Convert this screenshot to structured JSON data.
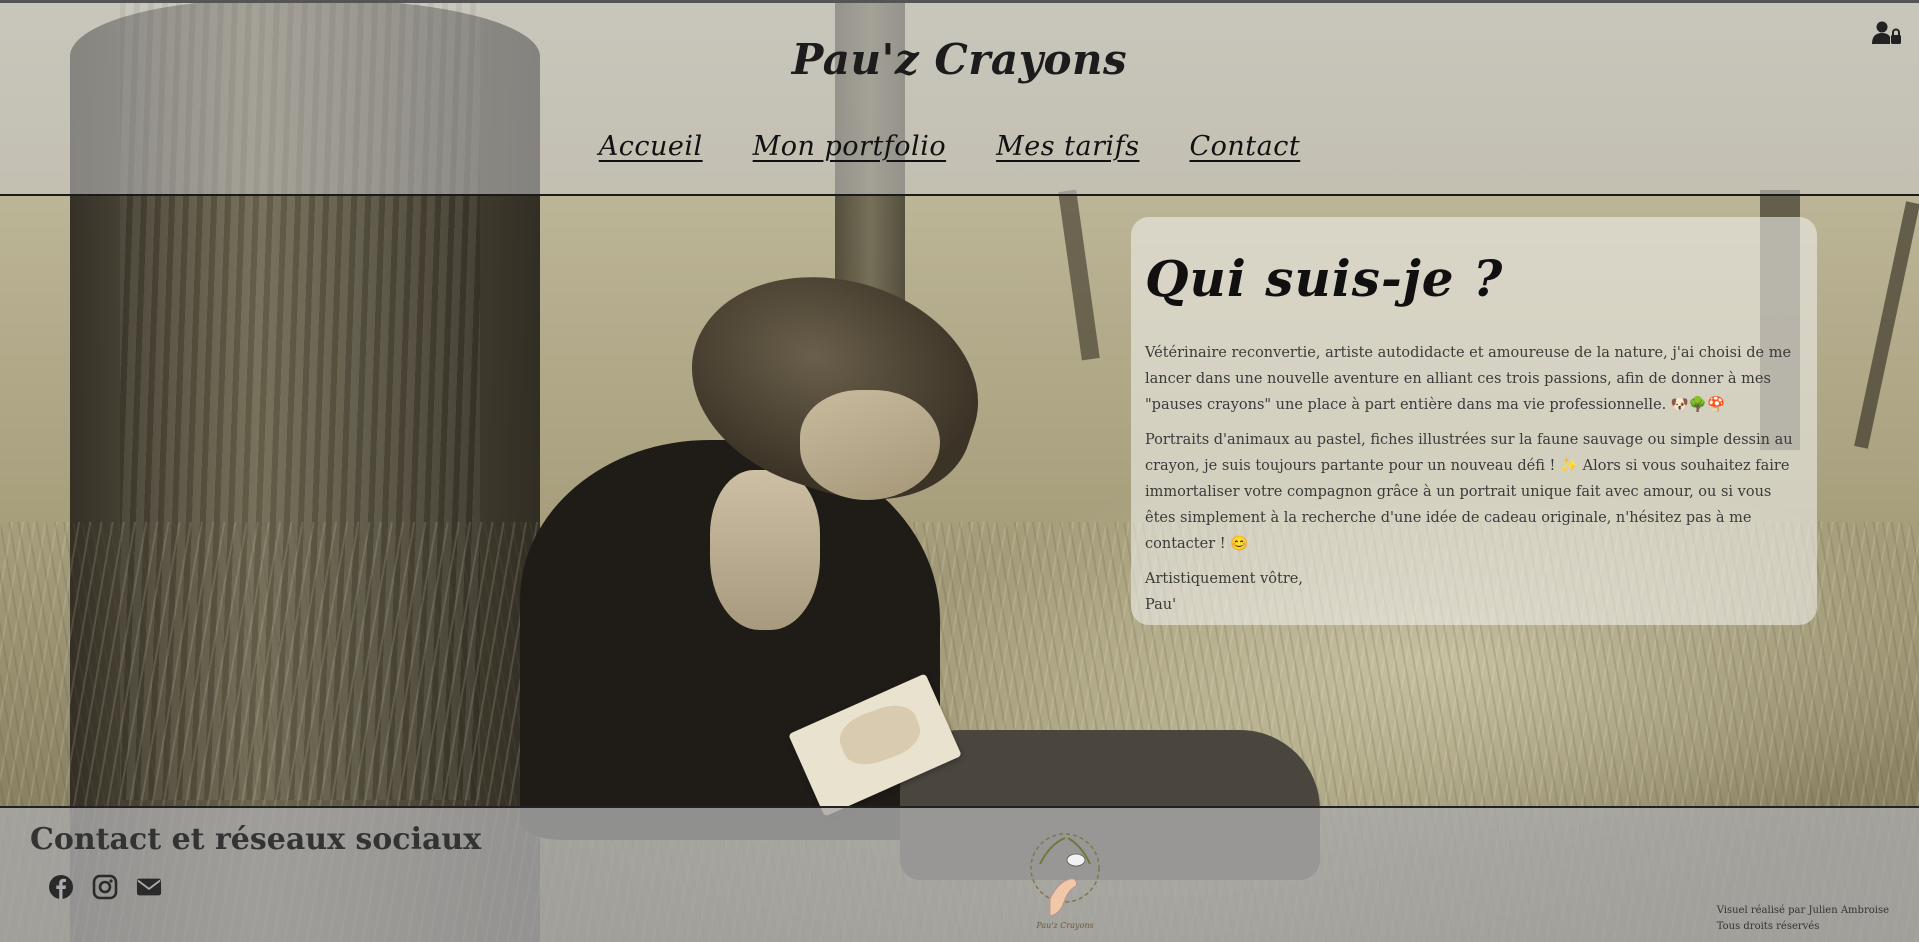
{
  "header": {
    "site_title": "Pau'z Crayons",
    "nav": [
      {
        "label": "Accueil"
      },
      {
        "label": "Mon portfolio"
      },
      {
        "label": "Mes tarifs"
      },
      {
        "label": "Contact"
      }
    ],
    "login_icon": "user-lock-icon"
  },
  "about": {
    "title": "Qui suis-je ?",
    "paragraphs": [
      "Vétérinaire reconvertie, artiste autodidacte et amoureuse de la nature, j'ai choisi de me lancer dans une nouvelle aventure en alliant ces trois passions, afin de donner à mes \"pauses crayons\" une place à part entière dans ma vie professionnelle. 🐶🌳🍄",
      "Portraits d'animaux au pastel, fiches illustrées sur la faune sauvage ou simple dessin au crayon, je suis toujours partante pour un nouveau défi ! ✨ Alors si vous souhaitez faire immortaliser votre compagnon grâce à un portrait unique fait avec amour, ou si vous êtes simplement à la recherche d'une idée de cadeau originale, n'hésitez pas à me contacter ! 😊"
    ],
    "signature_line1": "Artistiquement vôtre,",
    "signature_line2": "Pau'"
  },
  "footer": {
    "title": "Contact et réseaux sociaux",
    "social": [
      {
        "icon": "facebook-icon"
      },
      {
        "icon": "instagram-icon"
      },
      {
        "icon": "email-icon"
      }
    ],
    "logo_text": "Pau'z Crayons",
    "credit_line1": "Visuel réalisé par Julien Ambroise",
    "credit_line2": "Tous droits réservés"
  },
  "colors": {
    "header_bg": "#c8c8c8",
    "card_bg": "#eeece6",
    "footer_bg": "#aaaaaa",
    "text_dark": "#111111"
  }
}
